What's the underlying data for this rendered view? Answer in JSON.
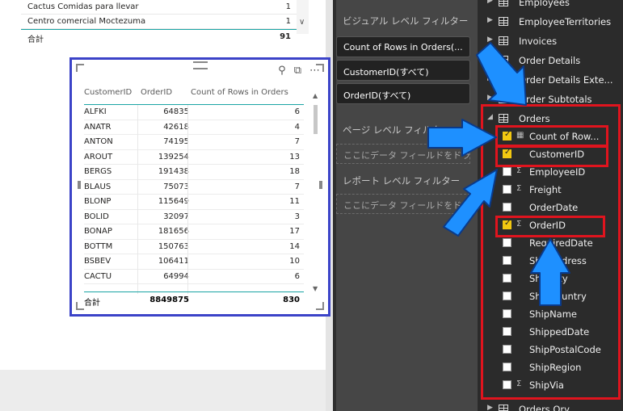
{
  "top_table": {
    "rows": [
      {
        "name": "Cactus Comidas para llevar",
        "value": "1"
      },
      {
        "name": "Centro comercial Moctezuma",
        "value": "1"
      }
    ],
    "total_label": "合計",
    "total_value": "91"
  },
  "visual": {
    "headers": [
      "CustomerID",
      "OrderID",
      "Count of Rows in Orders"
    ],
    "rows": [
      [
        "ALFKI",
        "64835",
        "6"
      ],
      [
        "ANATR",
        "42618",
        "4"
      ],
      [
        "ANTON",
        "74195",
        "7"
      ],
      [
        "AROUT",
        "139254",
        "13"
      ],
      [
        "BERGS",
        "191438",
        "18"
      ],
      [
        "BLAUS",
        "75073",
        "7"
      ],
      [
        "BLONP",
        "115649",
        "11"
      ],
      [
        "BOLID",
        "32097",
        "3"
      ],
      [
        "BONAP",
        "181656",
        "17"
      ],
      [
        "BOTTM",
        "150763",
        "14"
      ],
      [
        "BSBEV",
        "106411",
        "10"
      ],
      [
        "CACTU",
        "64994",
        "6"
      ]
    ],
    "total": [
      "合計",
      "8849875",
      "830"
    ]
  },
  "filters": {
    "visual_level_title": "ビジュアル レベル フィルター",
    "cards": [
      "Count of Rows in Orders(...",
      "CustomerID(すべて)",
      "OrderID(すべて)"
    ],
    "page_level_title": "ページ レベル フィルター",
    "page_drop": "ここにデータ フィールドをドラッグします",
    "report_level_title": "レポート レベル フィルター",
    "report_drop": "ここにデータ フィールドをドラッグします"
  },
  "fields": {
    "tables_top": [
      "Employees",
      "EmployeeTerritories",
      "Invoices",
      "Order Details",
      "Order Details Exte...",
      "Order Subtotals"
    ],
    "orders_table": "Orders",
    "orders_fields": [
      {
        "label": "Count of Row...",
        "checked": true,
        "icon": "calc"
      },
      {
        "label": "CustomerID",
        "checked": true,
        "icon": ""
      },
      {
        "label": "EmployeeID",
        "checked": false,
        "icon": "sigma"
      },
      {
        "label": "Freight",
        "checked": false,
        "icon": "sigma"
      },
      {
        "label": "OrderDate",
        "checked": false,
        "icon": ""
      },
      {
        "label": "OrderID",
        "checked": true,
        "icon": "sigma"
      },
      {
        "label": "RequiredDate",
        "checked": false,
        "icon": ""
      },
      {
        "label": "ShipAddress",
        "checked": false,
        "icon": ""
      },
      {
        "label": "ShipCity",
        "checked": false,
        "icon": ""
      },
      {
        "label": "ShipCountry",
        "checked": false,
        "icon": ""
      },
      {
        "label": "ShipName",
        "checked": false,
        "icon": ""
      },
      {
        "label": "ShippedDate",
        "checked": false,
        "icon": ""
      },
      {
        "label": "ShipPostalCode",
        "checked": false,
        "icon": ""
      },
      {
        "label": "ShipRegion",
        "checked": false,
        "icon": ""
      },
      {
        "label": "ShipVia",
        "checked": false,
        "icon": "sigma"
      }
    ],
    "tables_bottom": [
      "Orders Qry"
    ]
  },
  "colors": {
    "highlight_red": "#e0141e",
    "selection_blue": "#3b43c8",
    "arrow_blue": "#1e90ff",
    "check_yellow": "#f2c811"
  }
}
